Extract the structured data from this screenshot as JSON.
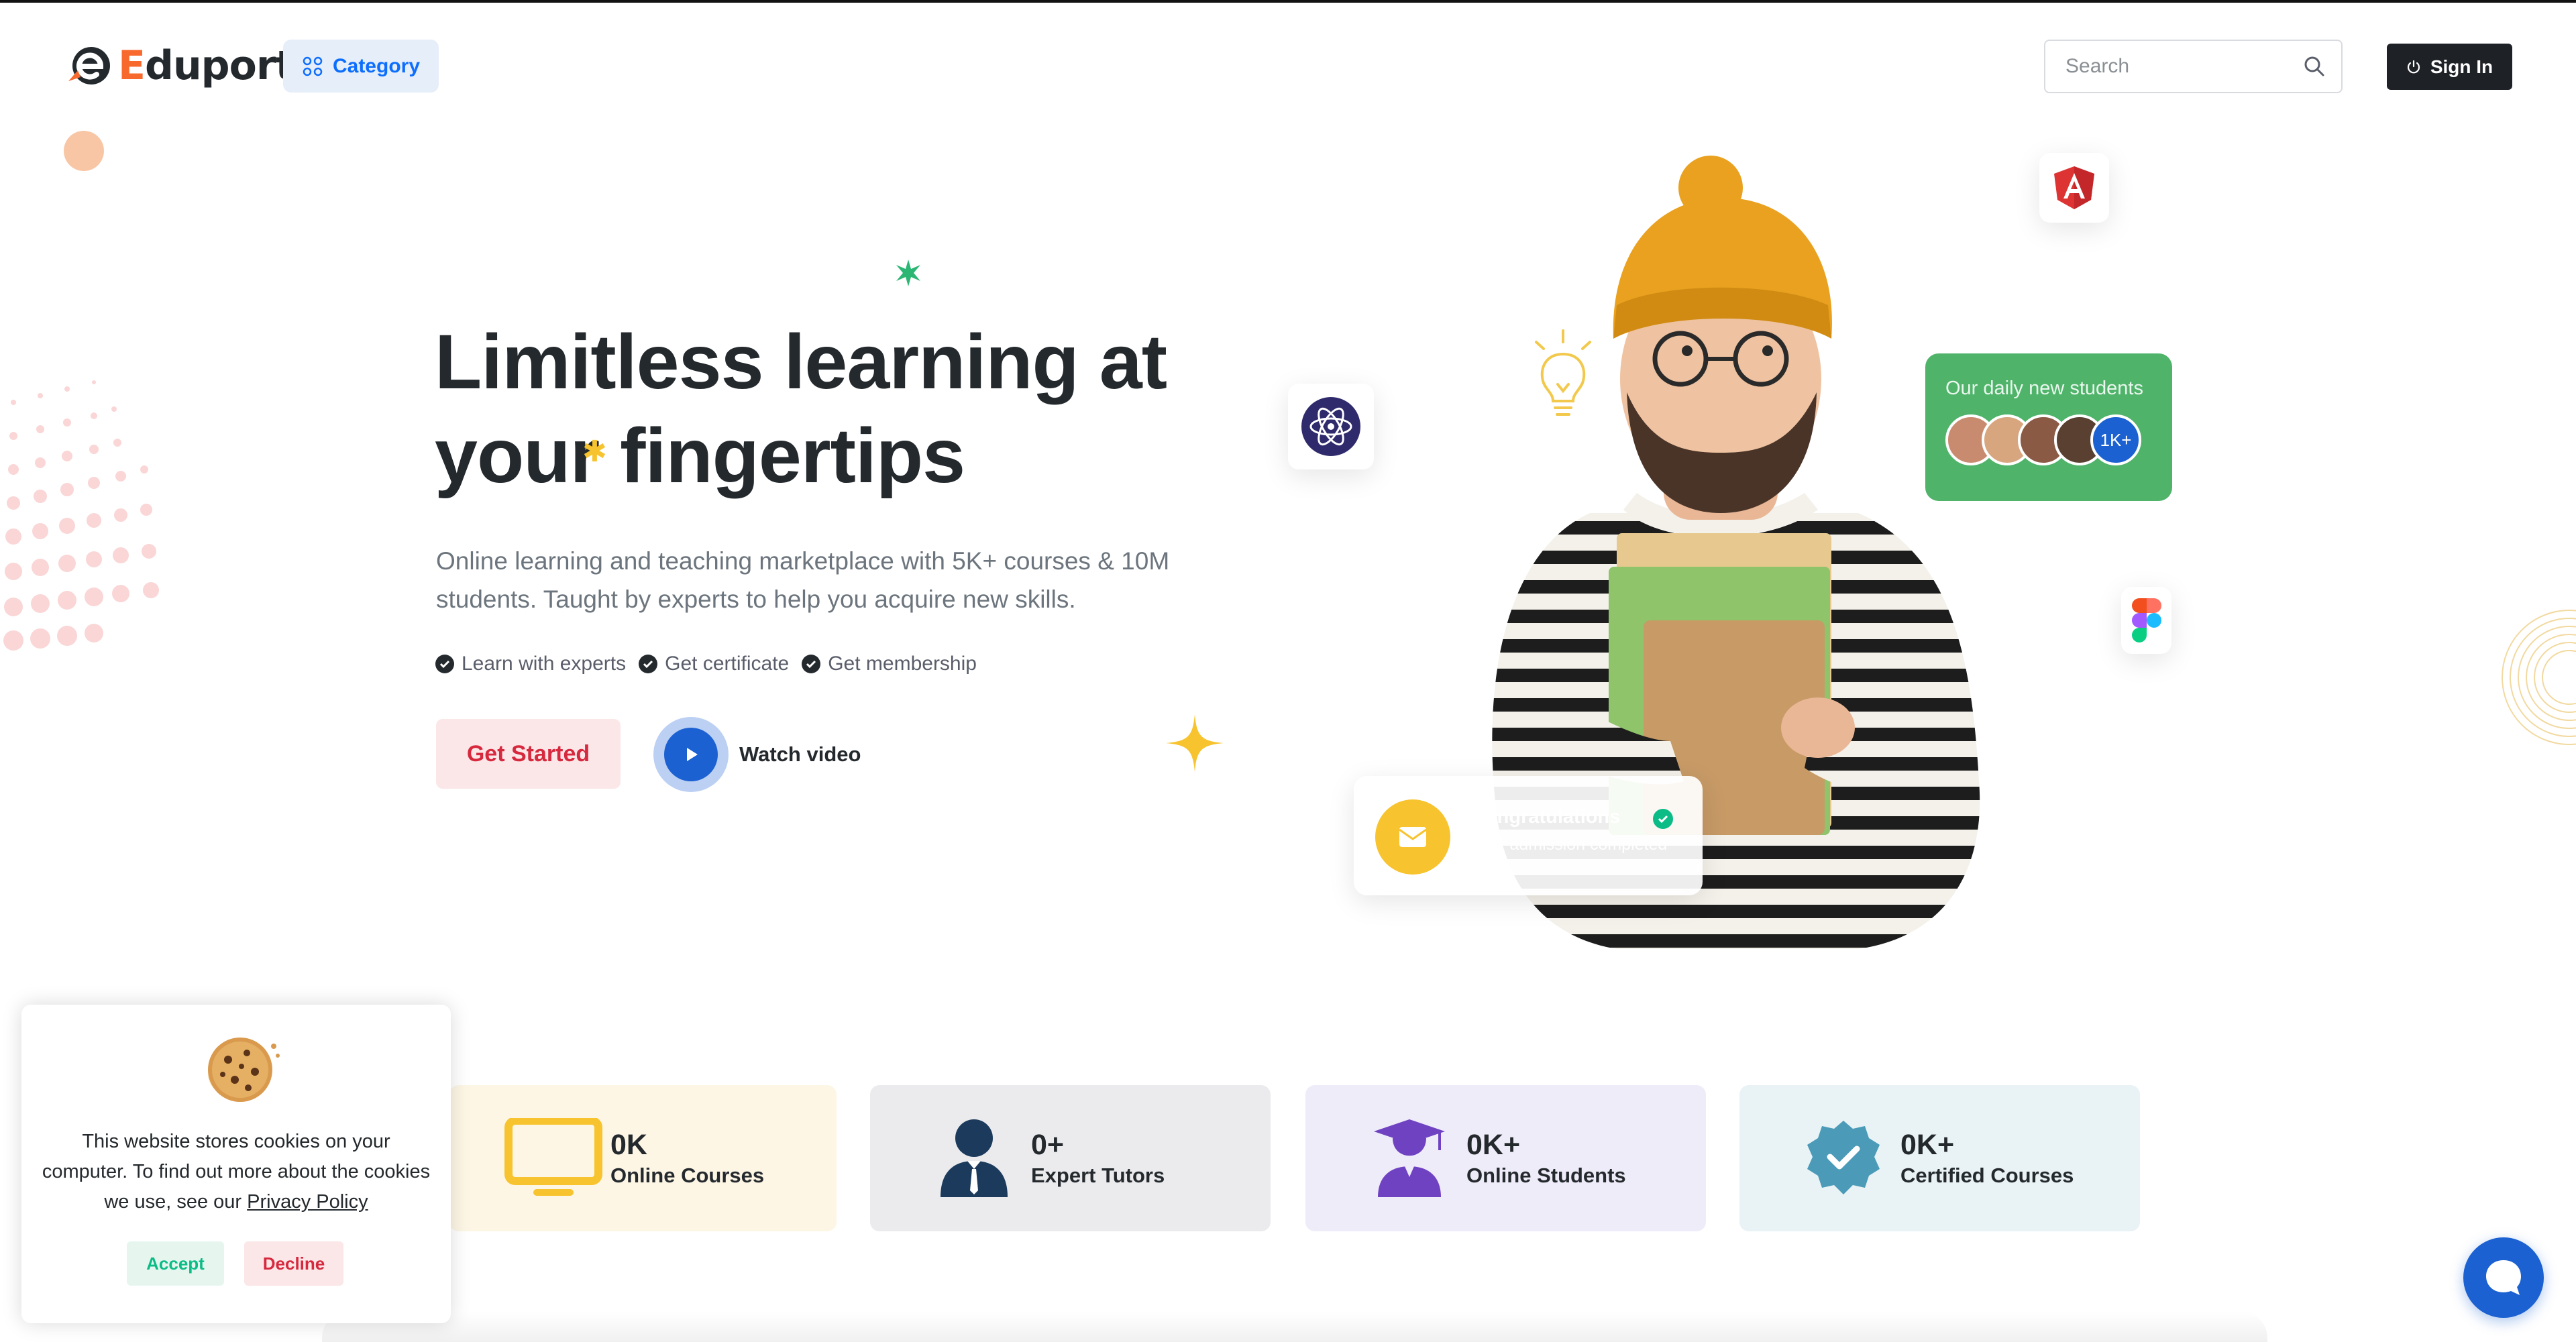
{
  "header": {
    "logo_prefix": "E",
    "logo_rest": "duport",
    "category_label": "Category",
    "search_placeholder": "Search",
    "signin_label": "Sign In"
  },
  "hero": {
    "title_line1": "Limitless learning at",
    "title_line2_a": "your",
    "title_line2_b": "fingertips",
    "description": "Online learning and teaching marketplace with 5K+ courses & 10M students. Taught by experts to help you acquire new skills.",
    "features": [
      "Learn with experts",
      "Get certificate",
      "Get membership"
    ],
    "cta_primary": "Get Started",
    "cta_video": "Watch video"
  },
  "floating": {
    "daily_title": "Our daily new students",
    "daily_count": "1K+",
    "congrats_title": "Congratulations",
    "congrats_sub": "Your admission completed"
  },
  "stats": [
    {
      "value": "0K",
      "label": "Online Courses",
      "icon": "tv-icon"
    },
    {
      "value": "0+",
      "label": "Expert Tutors",
      "icon": "tutor-icon"
    },
    {
      "value": "0K+",
      "label": "Online Students",
      "icon": "student-icon"
    },
    {
      "value": "0K+",
      "label": "Certified Courses",
      "icon": "certified-icon"
    }
  ],
  "cookie": {
    "text_before": "This website stores cookies on your computer. To find out more about the cookies we use, see our ",
    "link_text": "Privacy Policy",
    "accept_label": "Accept",
    "decline_label": "Decline"
  },
  "colors": {
    "brand_orange": "#f7692d",
    "primary_blue": "#1b61d1",
    "danger": "#d6293e",
    "success": "#0cbc87",
    "warning": "#f7c32e"
  }
}
